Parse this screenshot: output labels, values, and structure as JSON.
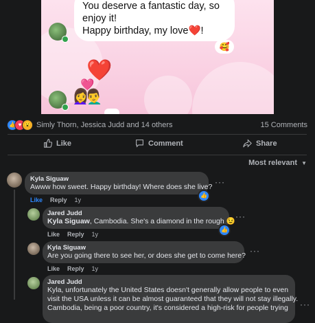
{
  "chat": {
    "message_lines": [
      "You deserve a fantastic day, so",
      "enjoy it!",
      "Happy birthday, my love"
    ],
    "message_heart": "❤️",
    "reaction_emoji": "🥰",
    "big_emoji": "❤️",
    "couple_emoji": "👩‍❤️‍👨"
  },
  "post": {
    "reaction_icons": [
      "like-icon",
      "love-icon",
      "wow-icon"
    ],
    "reacted_by": "Simly Thorn, Jessica Judd and 14 others",
    "comment_count": "15 Comments",
    "actions": {
      "like": "Like",
      "comment": "Comment",
      "share": "Share"
    },
    "sort_label": "Most relevant"
  },
  "comments": [
    {
      "author": "Kyla Siguaw",
      "text": "Awww how sweet. Happy birthday! Where does she live?",
      "like": "Like",
      "reply": "Reply",
      "time": "1y"
    },
    {
      "author": "Jared Judd",
      "mention": "Kyla Siguaw",
      "text": ", Cambodia. She's a diamond in the rough",
      "emoji": "😉",
      "like": "Like",
      "reply": "Reply",
      "time": "1y"
    },
    {
      "author": "Kyla Siguaw",
      "text": "Are you going there to see her, or does she get to come here?",
      "like": "Like",
      "reply": "Reply",
      "time": "1y"
    },
    {
      "author": "Jared Judd",
      "text_lines": [
        "Kyla, unfortunately the United States doesn't generally allow people to even",
        "visit the USA unless it can be almost guaranteed that they will not stay illegally.",
        "Cambodia, being a poor country, it's considered a high-risk for people trying"
      ]
    }
  ],
  "colors": {
    "background": "#18191a",
    "bubble": "#3a3b3c",
    "accent": "#2d88ff"
  }
}
